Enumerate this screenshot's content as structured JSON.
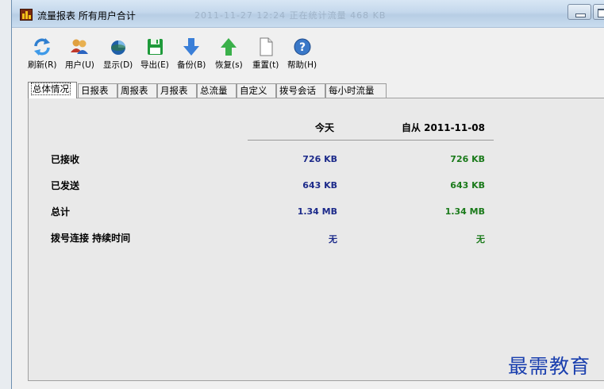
{
  "window": {
    "title": "流量报表 所有用户合计",
    "title_ghost": "2011-11-27 12:24   正在统计流量   468 KB"
  },
  "toolbar": [
    {
      "label": "刷新(R)",
      "icon": "refresh-icon",
      "name": "refresh-button"
    },
    {
      "label": "用户(U)",
      "icon": "users-icon",
      "name": "users-button"
    },
    {
      "label": "显示(D)",
      "icon": "display-icon",
      "name": "display-button"
    },
    {
      "label": "导出(E)",
      "icon": "save-disk-icon",
      "name": "export-button"
    },
    {
      "label": "备份(B)",
      "icon": "arrow-down-icon",
      "name": "backup-button"
    },
    {
      "label": "恢复(s)",
      "icon": "arrow-up-icon",
      "name": "restore-button"
    },
    {
      "label": "重置(t)",
      "icon": "blank-page-icon",
      "name": "reset-button"
    },
    {
      "label": "帮助(H)",
      "icon": "help-icon",
      "name": "help-button"
    }
  ],
  "tabs": [
    "总体情况",
    "日报表",
    "周报表",
    "月报表",
    "总流量",
    "自定义",
    "拨号会话",
    "每小时流量"
  ],
  "active_tab": "总体情况",
  "table": {
    "col_today": "今天",
    "col_since": "自从 2011-11-08",
    "rows": [
      {
        "label": "已接收",
        "today": "726 KB",
        "since": "726 KB"
      },
      {
        "label": "已发送",
        "today": "643 KB",
        "since": "643 KB"
      },
      {
        "label": "总计",
        "today": "1.34 MB",
        "since": "1.34 MB"
      },
      {
        "label": "拨号连接 持续时间",
        "today": "无",
        "since": "无"
      }
    ]
  },
  "watermark": "最需教育",
  "colors": {
    "today_value": "#1c2a8a",
    "since_value": "#1a7a1a"
  }
}
